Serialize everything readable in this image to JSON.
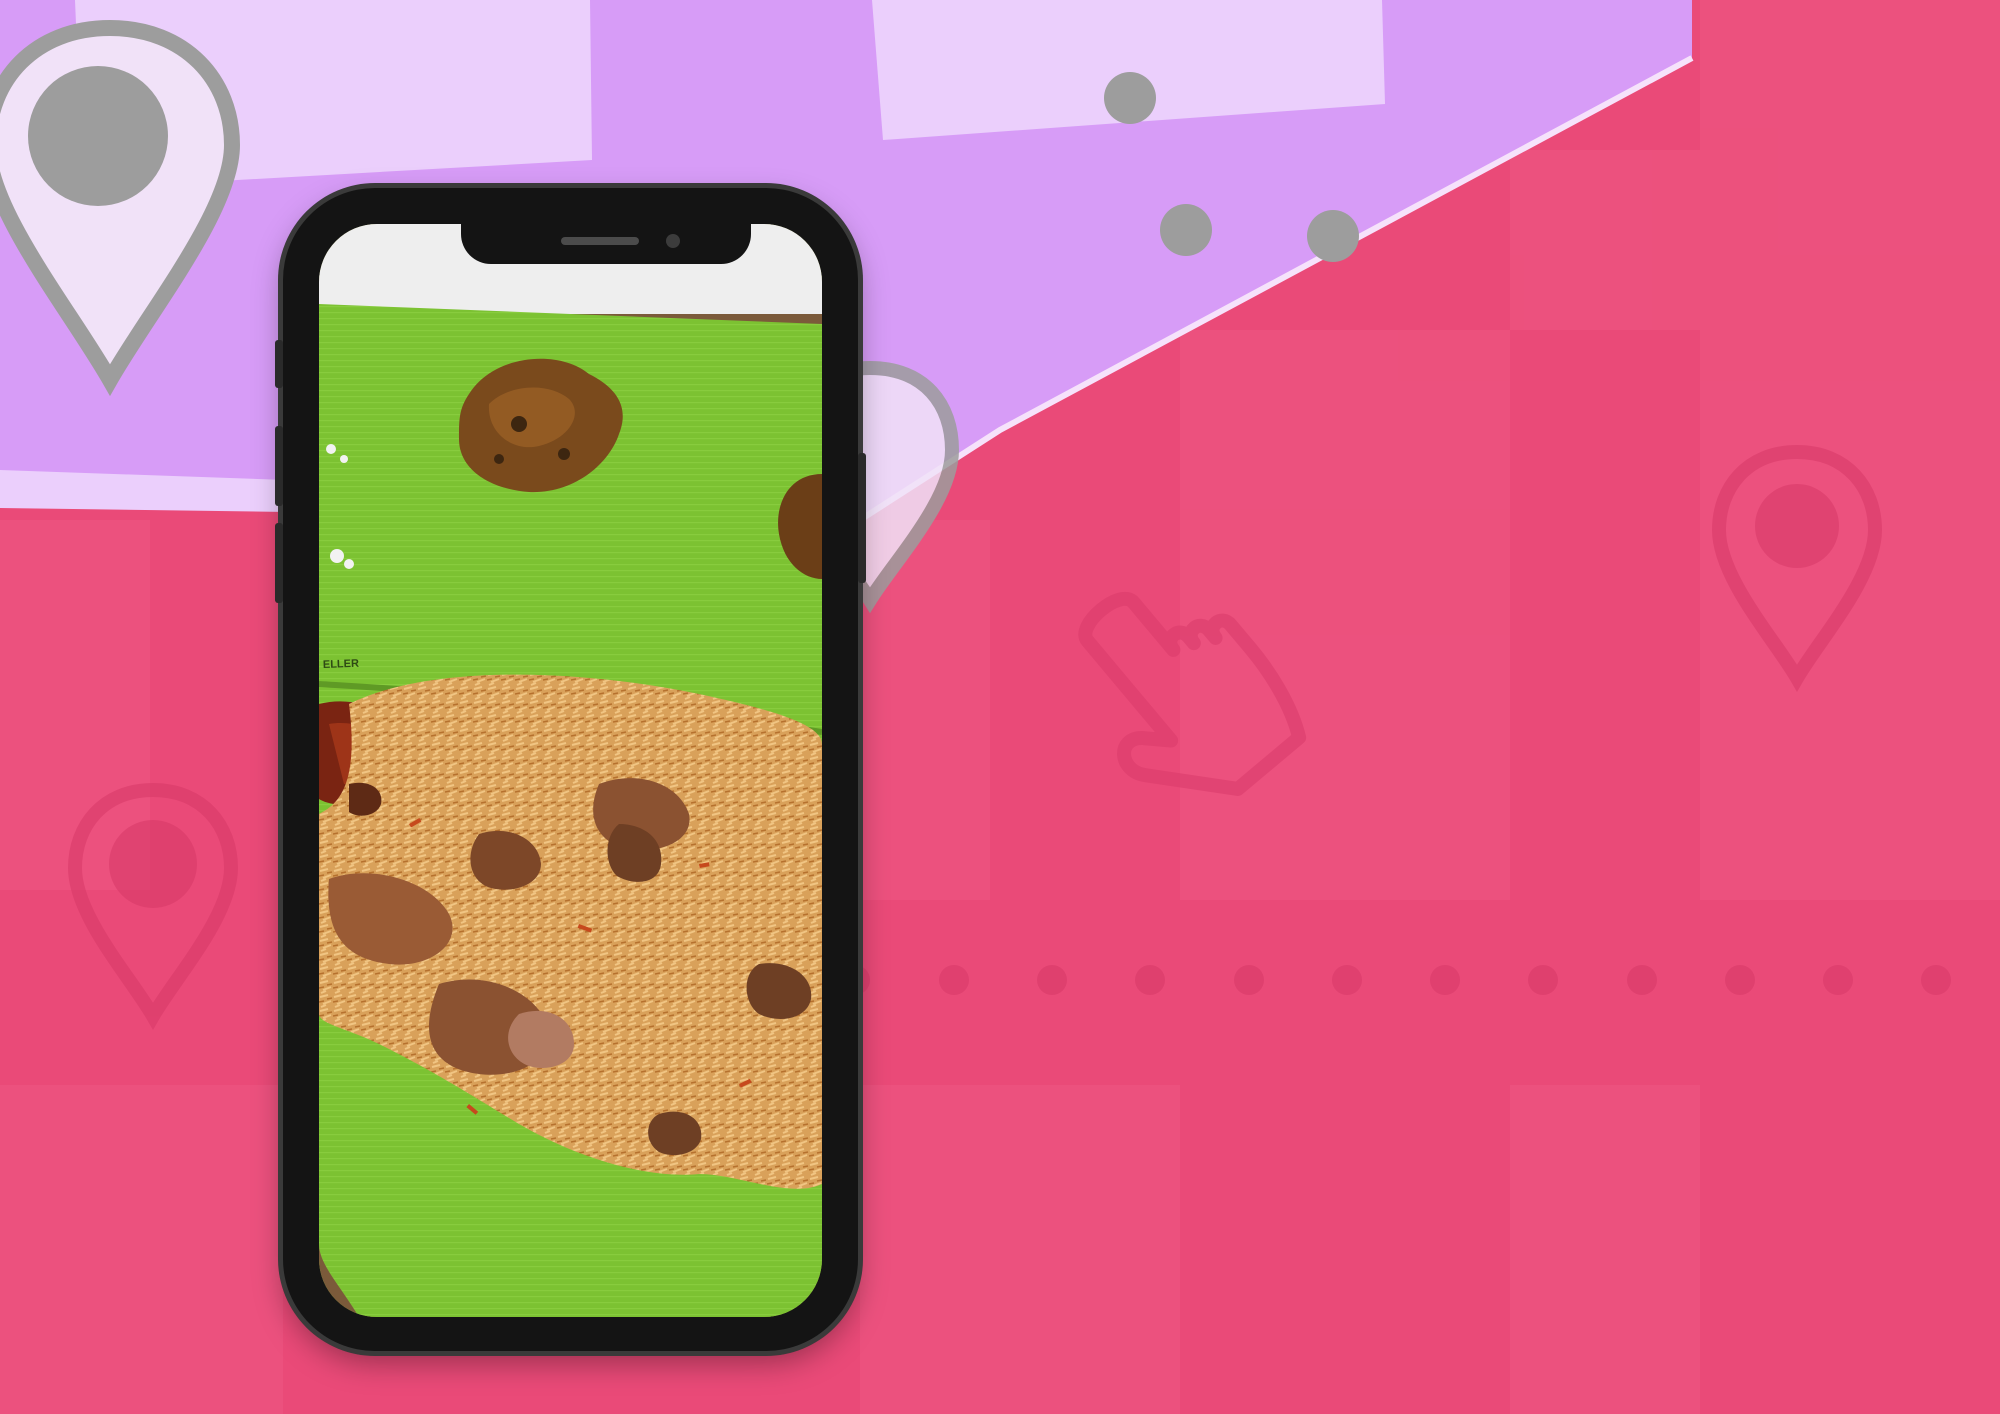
{
  "colors": {
    "background": "#ea4a78",
    "panel": "#d79cf7",
    "panel_card": "#ebcffc",
    "pin_grey": "#9d9d9d",
    "phone_body": "#141414",
    "leaf_green": "#7dc234",
    "rice": "#d6a15c"
  },
  "icons": {
    "location_pin": "location-pin-icon",
    "pointer_hand": "pointer-hand-icon"
  },
  "phone_screen": {
    "photo_subject": "biryani-on-banana-leaf",
    "leaf_print_fragment": "ELLER"
  }
}
